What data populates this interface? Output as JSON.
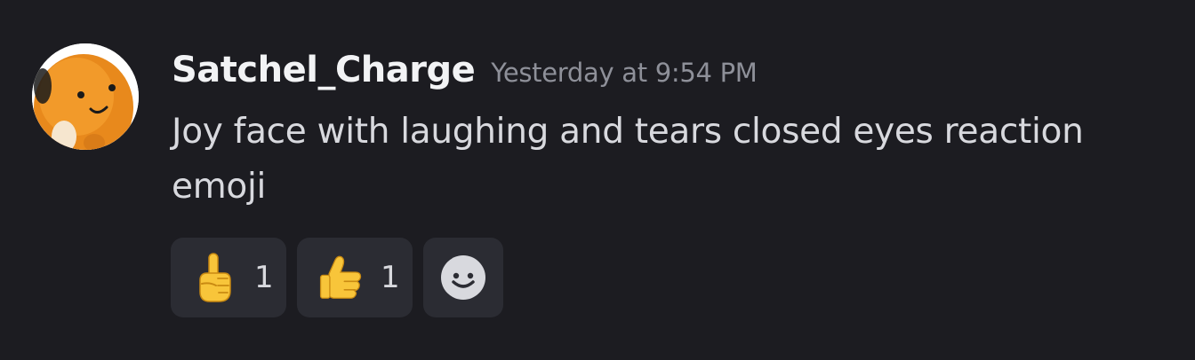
{
  "message": {
    "author": "Satchel_Charge",
    "timestamp": "Yesterday at 9:54 PM",
    "content": "Joy face with laughing and tears closed eyes reaction emoji",
    "avatar_icon": "orange-plush-avatar"
  },
  "reactions": [
    {
      "emoji": "pointing-up-emoji",
      "count": "1"
    },
    {
      "emoji": "thumbs-up-emoji",
      "count": "1"
    }
  ],
  "add_reaction": {
    "icon": "smiley-add-reaction-icon"
  },
  "colors": {
    "background": "#1c1c21",
    "reaction_bg": "#2b2c33",
    "username": "#f2f3f5",
    "timestamp": "#8e9099",
    "text": "#d8d9de",
    "emoji_yellow": "#f8c53a"
  }
}
